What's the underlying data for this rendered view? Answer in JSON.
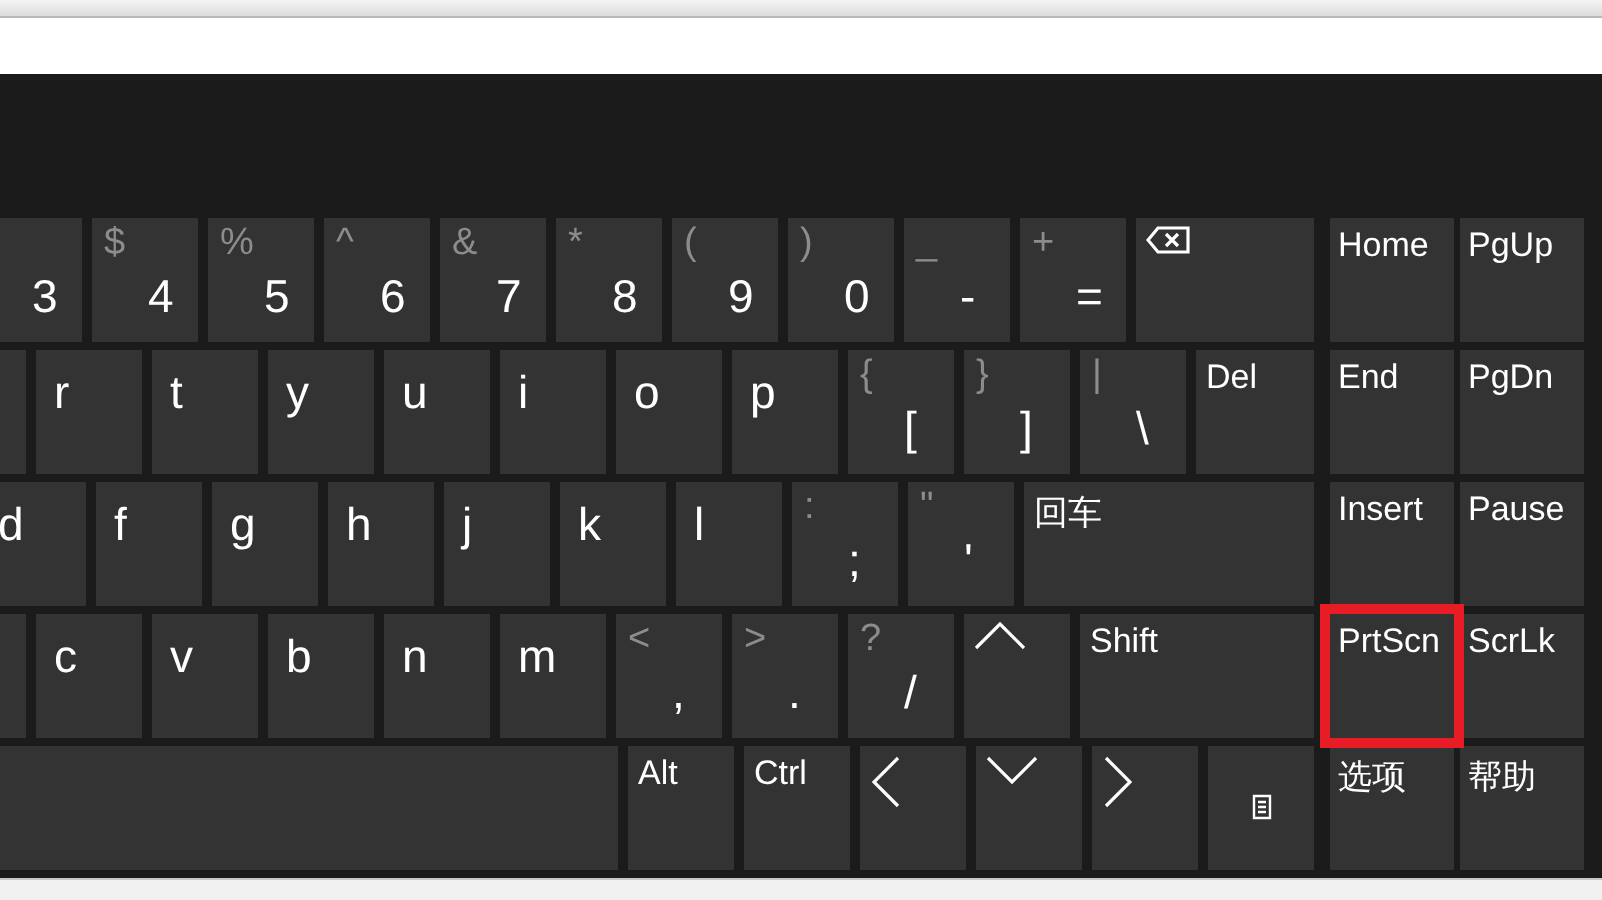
{
  "keyboard": {
    "rows": [
      {
        "keys": [
          {
            "kind": "digit",
            "main": "3"
          },
          {
            "kind": "symbol",
            "shift": "$",
            "main": "4"
          },
          {
            "kind": "symbol",
            "shift": "%",
            "main": "5"
          },
          {
            "kind": "symbol",
            "shift": "^",
            "main": "6"
          },
          {
            "kind": "symbol",
            "shift": "&",
            "main": "7"
          },
          {
            "kind": "symbol",
            "shift": "*",
            "main": "8"
          },
          {
            "kind": "symbol",
            "shift": "(",
            "main": "9"
          },
          {
            "kind": "symbol",
            "shift": ")",
            "main": "0"
          },
          {
            "kind": "symbol",
            "shift": "_",
            "main": "-"
          },
          {
            "kind": "symbol",
            "shift": "+",
            "main": "="
          },
          {
            "kind": "backspace"
          }
        ],
        "side": [
          {
            "label": "Home",
            "highlighted": false
          },
          {
            "label": "PgUp",
            "highlighted": false
          }
        ]
      },
      {
        "keys": [
          {
            "kind": "blank"
          },
          {
            "kind": "letter",
            "main": "r"
          },
          {
            "kind": "letter",
            "main": "t"
          },
          {
            "kind": "letter",
            "main": "y"
          },
          {
            "kind": "letter",
            "main": "u"
          },
          {
            "kind": "letter",
            "main": "i"
          },
          {
            "kind": "letter",
            "main": "o"
          },
          {
            "kind": "letter",
            "main": "p"
          },
          {
            "kind": "symbol",
            "shift": "{",
            "main": "["
          },
          {
            "kind": "symbol",
            "shift": "}",
            "main": "]"
          },
          {
            "kind": "symbol",
            "shift": "|",
            "main": "\\"
          },
          {
            "kind": "label",
            "label": "Del"
          }
        ],
        "side": [
          {
            "label": "End",
            "highlighted": false
          },
          {
            "label": "PgDn",
            "highlighted": false
          }
        ]
      },
      {
        "keys": [
          {
            "kind": "letter",
            "main": "d"
          },
          {
            "kind": "letter",
            "main": "f"
          },
          {
            "kind": "letter",
            "main": "g"
          },
          {
            "kind": "letter",
            "main": "h"
          },
          {
            "kind": "letter",
            "main": "j"
          },
          {
            "kind": "letter",
            "main": "k"
          },
          {
            "kind": "letter",
            "main": "l"
          },
          {
            "kind": "symbol",
            "shift": ":",
            "main": ";"
          },
          {
            "kind": "symbol",
            "shift": "\"",
            "main": "'"
          },
          {
            "kind": "label",
            "label": "回车"
          }
        ],
        "side": [
          {
            "label": "Insert",
            "highlighted": false
          },
          {
            "label": "Pause",
            "highlighted": false
          }
        ]
      },
      {
        "keys": [
          {
            "kind": "blank"
          },
          {
            "kind": "letter",
            "main": "c"
          },
          {
            "kind": "letter",
            "main": "v"
          },
          {
            "kind": "letter",
            "main": "b"
          },
          {
            "kind": "letter",
            "main": "n"
          },
          {
            "kind": "letter",
            "main": "m"
          },
          {
            "kind": "symbol",
            "shift": "<",
            "main": ","
          },
          {
            "kind": "symbol",
            "shift": ">",
            "main": "."
          },
          {
            "kind": "symbol",
            "shift": "?",
            "main": "/"
          },
          {
            "kind": "up"
          },
          {
            "kind": "label",
            "label": "Shift"
          }
        ],
        "side": [
          {
            "label": "PrtScn",
            "highlighted": true
          },
          {
            "label": "ScrLk",
            "highlighted": false
          }
        ]
      },
      {
        "keys": [
          {
            "kind": "blank"
          },
          {
            "kind": "label",
            "label": "Alt"
          },
          {
            "kind": "label",
            "label": "Ctrl"
          },
          {
            "kind": "left"
          },
          {
            "kind": "down"
          },
          {
            "kind": "right"
          },
          {
            "kind": "menu"
          }
        ],
        "side": [
          {
            "label": "选项",
            "highlighted": false
          },
          {
            "label": "帮助",
            "highlighted": false
          }
        ]
      }
    ]
  }
}
